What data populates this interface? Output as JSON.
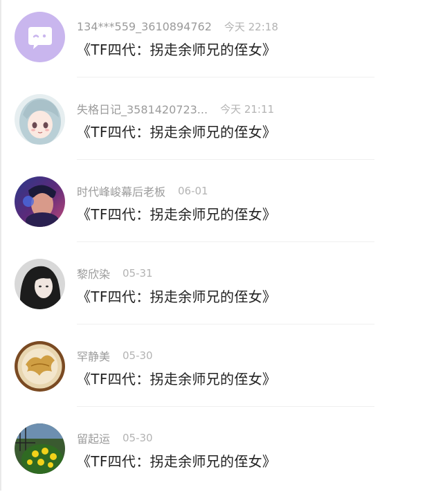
{
  "comments": [
    {
      "username": "134***559_3610894762",
      "time": "今天 22:18",
      "message": "《TF四代：拐走余师兄的侄女》",
      "avatar_icon": "chat-bubble-face-icon",
      "avatar_color": "#c8b4ec"
    },
    {
      "username": "失格日记_3581420723...",
      "time": "今天 21:11",
      "message": "《TF四代：拐走余师兄的侄女》",
      "avatar_icon": "anime-girl-avatar",
      "avatar_color": "#cfe3ea"
    },
    {
      "username": "时代峰峻幕后老板",
      "time": "06-01",
      "message": "《TF四代：拐走余师兄的侄女》",
      "avatar_icon": "neon-portrait-avatar",
      "avatar_color": "#3a3070"
    },
    {
      "username": "黎欣染",
      "time": "05-31",
      "message": "《TF四代：拐走余师兄的侄女》",
      "avatar_icon": "dark-portrait-avatar",
      "avatar_color": "#2b2b2b"
    },
    {
      "username": "罕静美",
      "time": "05-30",
      "message": "《TF四代：拐走余师兄的侄女》",
      "avatar_icon": "latte-art-avatar",
      "avatar_color": "#d8c09a"
    },
    {
      "username": "留起运",
      "time": "05-30",
      "message": "《TF四代：拐走余师兄的侄女》",
      "avatar_icon": "flowers-avatar",
      "avatar_color": "#3d6b2e"
    }
  ]
}
